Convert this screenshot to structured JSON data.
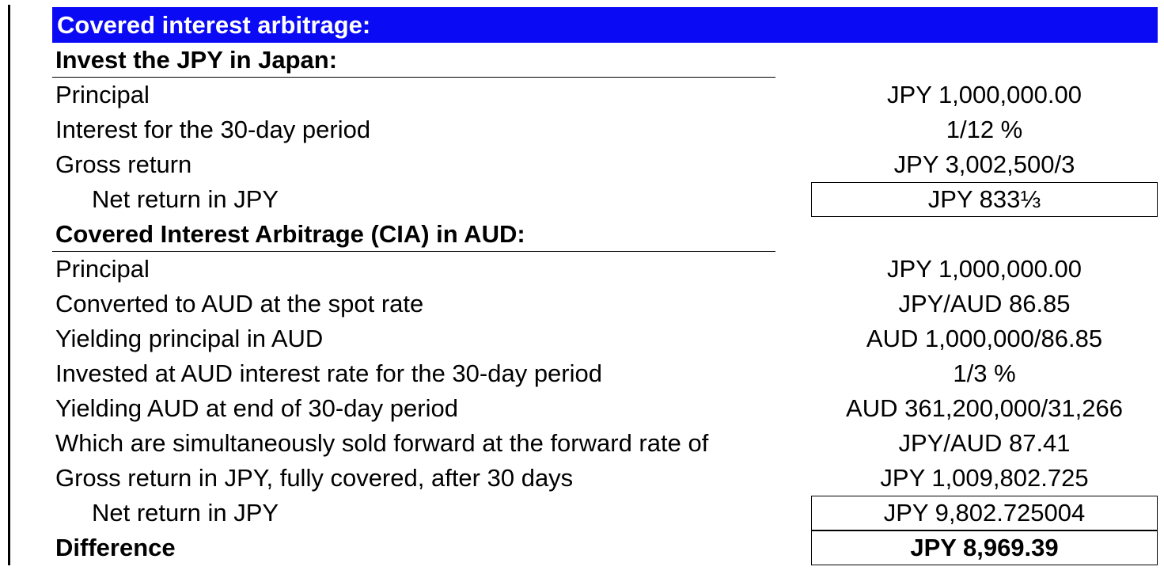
{
  "title": "Covered interest arbitrage:",
  "sections": [
    {
      "heading": "Invest the JPY in Japan:",
      "rows": [
        {
          "label": "Principal",
          "value": "JPY 1,000,000.00"
        },
        {
          "label": "Interest for the 30-day period",
          "value": "1/12 %"
        },
        {
          "label": "Gross return",
          "value": "JPY 3,002,500/3"
        },
        {
          "label": "Net return in JPY",
          "value": "JPY 833⅓"
        }
      ]
    },
    {
      "heading": "Covered Interest Arbitrage (CIA) in AUD:",
      "rows": [
        {
          "label": "Principal",
          "value": "JPY 1,000,000.00"
        },
        {
          "label": "Converted to AUD at the spot rate",
          "value": "JPY/AUD 86.85"
        },
        {
          "label": "Yielding principal in AUD",
          "value": "AUD 1,000,000/86.85"
        },
        {
          "label": "Invested at AUD interest rate for the 30-day period",
          "value": "1/3 %"
        },
        {
          "label": "Yielding AUD at end of 30-day period",
          "value": "AUD 361,200,000/31,266"
        },
        {
          "label": "Which are simultaneously sold forward at the forward rate of",
          "value": "JPY/AUD 87.41"
        },
        {
          "label": "Gross return in JPY, fully covered, after 30 days",
          "value": "JPY 1,009,802.725"
        },
        {
          "label": "Net return in JPY",
          "value": "JPY 9,802.725004"
        }
      ]
    }
  ],
  "difference": {
    "label": "Difference",
    "value": "JPY 8,969.39"
  }
}
